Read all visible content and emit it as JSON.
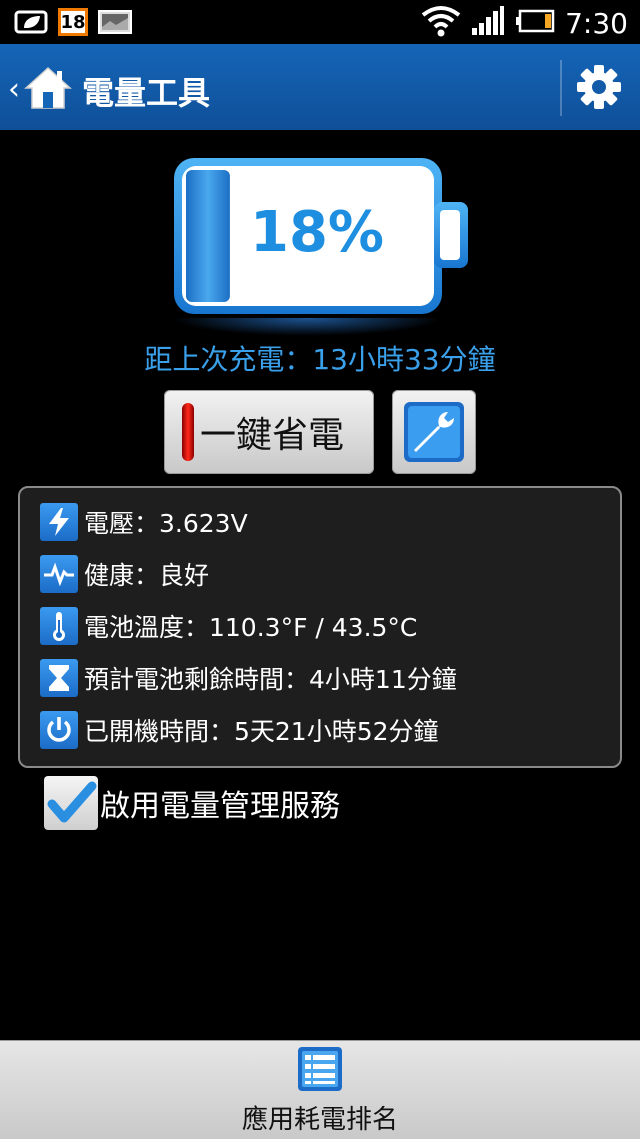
{
  "status_bar": {
    "notification_badge": "18",
    "time": "7:30",
    "icons": [
      "leaf-icon",
      "calendar-badge-icon",
      "image-icon",
      "wifi-icon",
      "signal-icon",
      "battery-icon"
    ]
  },
  "action_bar": {
    "title": "電量工具",
    "icons": [
      "back-chevron-icon",
      "home-icon",
      "gear-icon"
    ]
  },
  "battery": {
    "level_percent": 18,
    "level_text": "18%",
    "since_last_charge": "距上次充電：13小時33分鐘"
  },
  "buttons": {
    "power_save_label": "一鍵省電",
    "tools_icon": "wrench-icon"
  },
  "info": {
    "voltage": "電壓：3.623V",
    "health": "健康：良好",
    "temperature": "電池溫度：110.3°F / 43.5°C",
    "remaining": "預計電池剩餘時間：4小時11分鐘",
    "uptime": "已開機時間：5天21小時52分鐘"
  },
  "service": {
    "label": "啟用電量管理服務",
    "checked": true
  },
  "bottom": {
    "label": "應用耗電排名"
  },
  "colors": {
    "accent": "#1e8ee0",
    "action_bar": "#1565b8",
    "subtitle": "#3aa0ea"
  }
}
